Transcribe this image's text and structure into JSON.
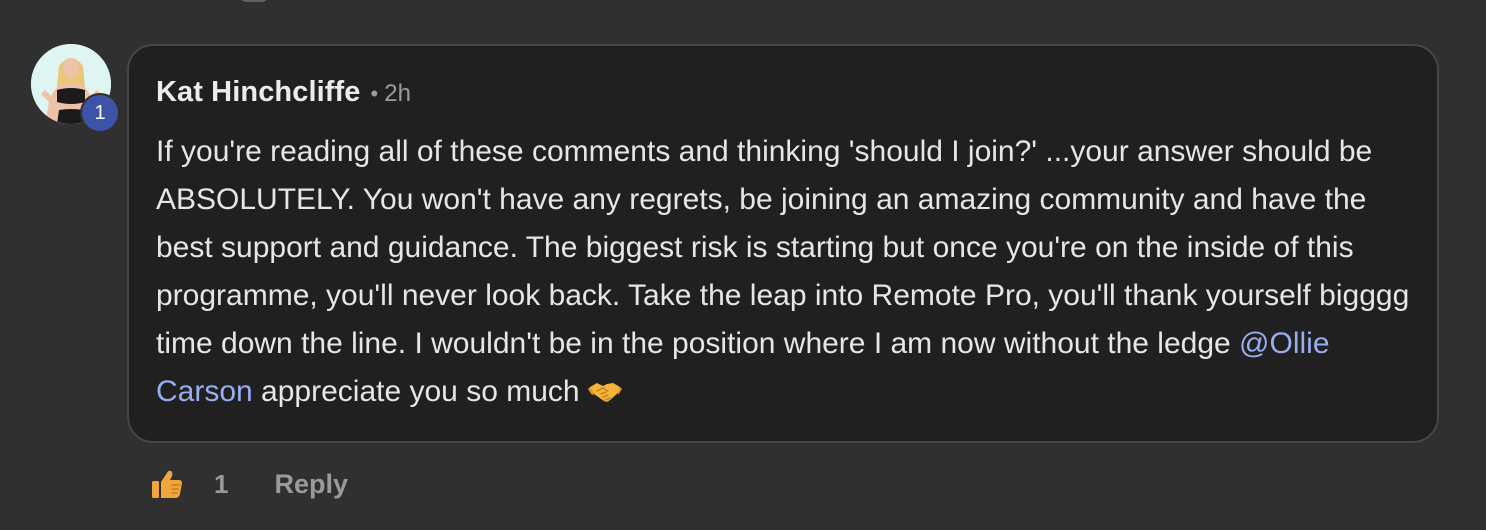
{
  "comment": {
    "author": "Kat Hinchcliffe",
    "separator": "•",
    "timestamp": "2h",
    "level": "1",
    "body_before_mention": "If you're reading all of these comments and thinking 'should I join?' ...your answer should be ABSOLUTELY. You won't have any regrets, be joining an amazing community and have the best support and guidance. The biggest risk is starting but once you're on the inside of this programme, you'll never look back. Take the leap into Remote Pro, you'll thank yourself bigggg time down the line. I wouldn't be in the position where I am now without the ledge ",
    "mention": "@Ollie Carson",
    "body_after_mention": " appreciate you so much ",
    "emoji_icon": "handshake-icon"
  },
  "actions": {
    "like_icon": "thumbs-up-icon",
    "like_count": "1",
    "reply_label": "Reply"
  },
  "colors": {
    "background": "#303030",
    "card": "#202020",
    "mention": "#98acef",
    "badge": "#3d53a6",
    "like_icon": "#f0a63c"
  }
}
